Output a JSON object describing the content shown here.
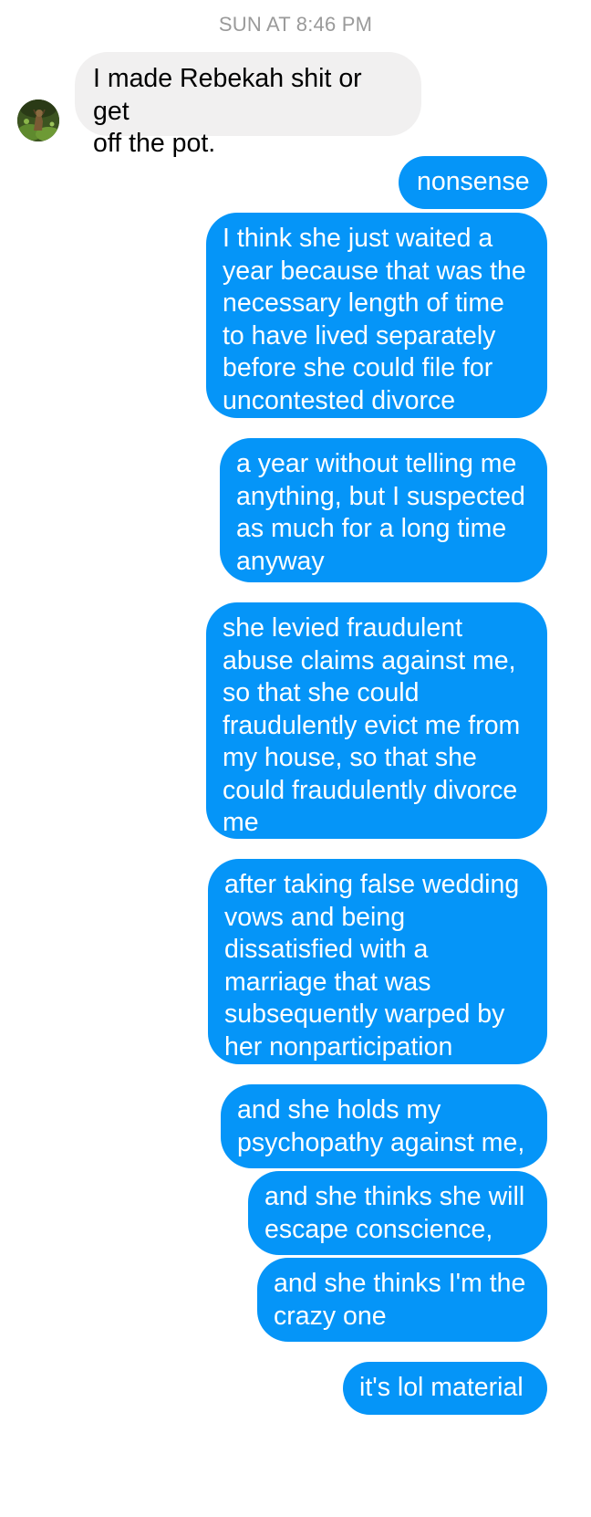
{
  "timestamp": "SUN AT 8:46 PM",
  "avatar_icon": "contact-avatar-photo",
  "colors": {
    "outgoing_bubble": "#0595f8",
    "incoming_bubble": "#f1f0f0",
    "timestamp_text": "#9a9a9a"
  },
  "messages": [
    {
      "sender": "them",
      "text": "I made Rebekah shit or get\noff the pot."
    },
    {
      "sender": "me",
      "text": "nonsense"
    },
    {
      "sender": "me",
      "text": "I think she just waited a\nyear because that was the\nnecessary length of time\nto have lived separately\nbefore she could file for\nuncontested divorce"
    },
    {
      "sender": "me",
      "text": "a year without telling me\nanything, but I suspected\nas much for a long time\nanyway"
    },
    {
      "sender": "me",
      "text": "she levied fraudulent\nabuse claims against me,\nso that she could\nfraudulently evict me from\nmy house, so that she\ncould fraudulently divorce\nme"
    },
    {
      "sender": "me",
      "text": "after taking false wedding\nvows and being\ndissatisfied with a\nmarriage that was\nsubsequently warped by\nher nonparticipation"
    },
    {
      "sender": "me",
      "text": "and she holds my\npsychopathy against me,"
    },
    {
      "sender": "me",
      "text": "and she thinks she will\nescape conscience,"
    },
    {
      "sender": "me",
      "text": "and she thinks I'm the\ncrazy one"
    },
    {
      "sender": "me",
      "text": "it's lol material"
    }
  ]
}
